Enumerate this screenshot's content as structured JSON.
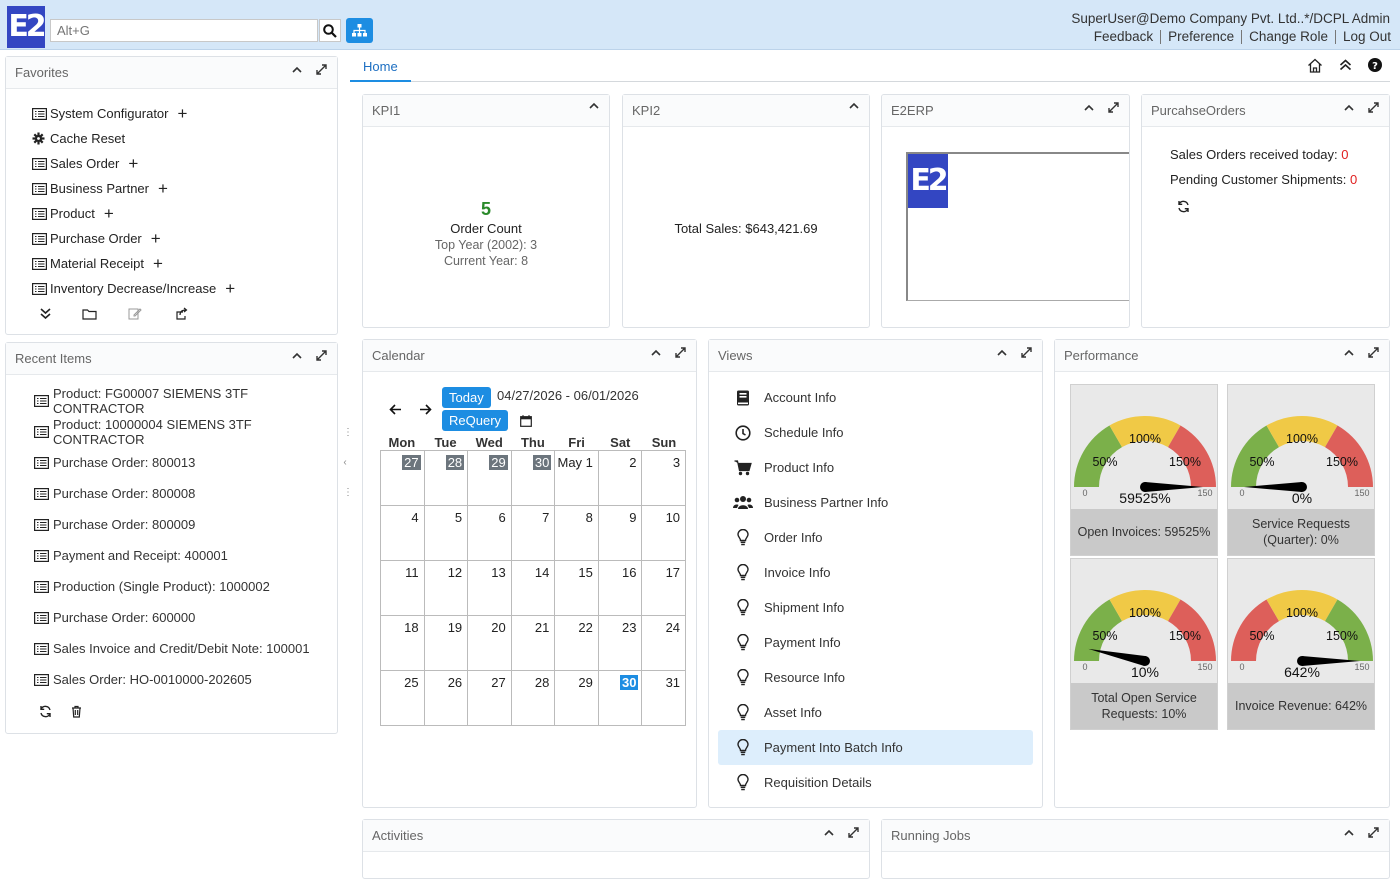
{
  "app": {
    "logo_text": "E2",
    "search_placeholder": "Alt+G",
    "user": "SuperUser@Demo Company Pvt. Ltd..*/DCPL Admin",
    "links": [
      "Feedback",
      "Preference",
      "Change Role",
      "Log Out"
    ]
  },
  "tabs": {
    "home": "Home"
  },
  "favorites": {
    "title": "Favorites",
    "items": [
      {
        "label": "System Configurator",
        "icon": "list-icon",
        "plus": "+"
      },
      {
        "label": "Cache Reset",
        "icon": "gear-icon",
        "plus": ""
      },
      {
        "label": "Sales Order",
        "icon": "list-icon",
        "plus": "+"
      },
      {
        "label": "Business Partner",
        "icon": "list-icon",
        "plus": "+"
      },
      {
        "label": "Product",
        "icon": "list-icon",
        "plus": "+"
      },
      {
        "label": "Purchase Order",
        "icon": "list-icon",
        "plus": "+"
      },
      {
        "label": "Material Receipt",
        "icon": "list-icon",
        "plus": "+"
      },
      {
        "label": "Inventory Decrease/Increase",
        "icon": "list-icon",
        "plus": "+"
      }
    ]
  },
  "recent": {
    "title": "Recent Items",
    "items": [
      "Product: FG00007 SIEMENS 3TF CONTRACTOR",
      "Product: 10000004 SIEMENS 3TF CONTRACTOR",
      "Purchase Order: 800013",
      "Purchase Order: 800008",
      "Purchase Order: 800009",
      "Payment and Receipt: 400001",
      "Production (Single Product): 1000002",
      "Purchase Order: 600000",
      "Sales Invoice and Credit/Debit Note: 100001",
      "Sales Order: HO-0010000-202605"
    ]
  },
  "kpi1": {
    "title": "KPI1",
    "value": "5",
    "label": "Order Count",
    "top_year": "Top Year (2002): 3",
    "current_year": "Current Year: 8"
  },
  "kpi2": {
    "title": "KPI2",
    "total_sales": "Total Sales: $643,421.69"
  },
  "e2erp": {
    "title": "E2ERP",
    "logo_text": "E2"
  },
  "purchase_orders": {
    "title": "PurcahseOrders",
    "received_label": "Sales Orders received today: ",
    "received_value": "0",
    "pending_label": "Pending Customer Shipments: ",
    "pending_value": "0"
  },
  "calendar": {
    "title": "Calendar",
    "today_btn": "Today",
    "requery_btn": "ReQuery",
    "range": "04/27/2026 - 06/01/2026",
    "days": [
      "Mon",
      "Tue",
      "Wed",
      "Thu",
      "Fri",
      "Sat",
      "Sun"
    ],
    "weeks": [
      [
        "27",
        "28",
        "29",
        "30",
        "May 1",
        "2",
        "3"
      ],
      [
        "4",
        "5",
        "6",
        "7",
        "8",
        "9",
        "10"
      ],
      [
        "11",
        "12",
        "13",
        "14",
        "15",
        "16",
        "17"
      ],
      [
        "18",
        "19",
        "20",
        "21",
        "22",
        "23",
        "24"
      ],
      [
        "25",
        "26",
        "27",
        "28",
        "29",
        "30",
        "31"
      ]
    ]
  },
  "views": {
    "title": "Views",
    "items": [
      {
        "label": "Account Info",
        "icon": "book-icon"
      },
      {
        "label": "Schedule Info",
        "icon": "clock-icon"
      },
      {
        "label": "Product Info",
        "icon": "cart-icon"
      },
      {
        "label": "Business Partner Info",
        "icon": "users-icon"
      },
      {
        "label": "Order Info",
        "icon": "lightbulb-icon"
      },
      {
        "label": "Invoice Info",
        "icon": "lightbulb-icon"
      },
      {
        "label": "Shipment Info",
        "icon": "lightbulb-icon"
      },
      {
        "label": "Payment Info",
        "icon": "lightbulb-icon"
      },
      {
        "label": "Resource Info",
        "icon": "lightbulb-icon"
      },
      {
        "label": "Asset Info",
        "icon": "lightbulb-icon"
      },
      {
        "label": "Payment Into Batch Info",
        "icon": "lightbulb-icon"
      },
      {
        "label": "Requisition Details",
        "icon": "lightbulb-icon"
      }
    ]
  },
  "performance": {
    "title": "Performance",
    "gauges": [
      {
        "value": "59525%",
        "label": "Open Invoices: 59525%",
        "min": "0",
        "max": "150",
        "t50": "50%",
        "t100": "100%",
        "t150": "150%",
        "reversed": false,
        "needle_fraction": 1.0
      },
      {
        "value": "0%",
        "label": "Service Requests (Quarter): 0%",
        "min": "0",
        "max": "150",
        "t50": "50%",
        "t100": "100%",
        "t150": "150%",
        "reversed": false,
        "needle_fraction": 0.0
      },
      {
        "value": "10%",
        "label": "Total Open Service Requests: 10%",
        "min": "0",
        "max": "150",
        "t50": "50%",
        "t100": "100%",
        "t150": "150%",
        "reversed": false,
        "needle_fraction": 0.067
      },
      {
        "value": "642%",
        "label": "Invoice Revenue: 642%",
        "min": "0",
        "max": "150",
        "t50": "50%",
        "t100": "100%",
        "t150": "150%",
        "reversed": true,
        "needle_fraction": 1.0
      }
    ]
  },
  "activities": {
    "title": "Activities"
  },
  "running_jobs": {
    "title": "Running Jobs"
  },
  "colors": {
    "accent": "#1d8de2",
    "kpi_green": "#2a8a2a",
    "alert_red": "#e02020",
    "logo_blue": "#3346c2"
  }
}
